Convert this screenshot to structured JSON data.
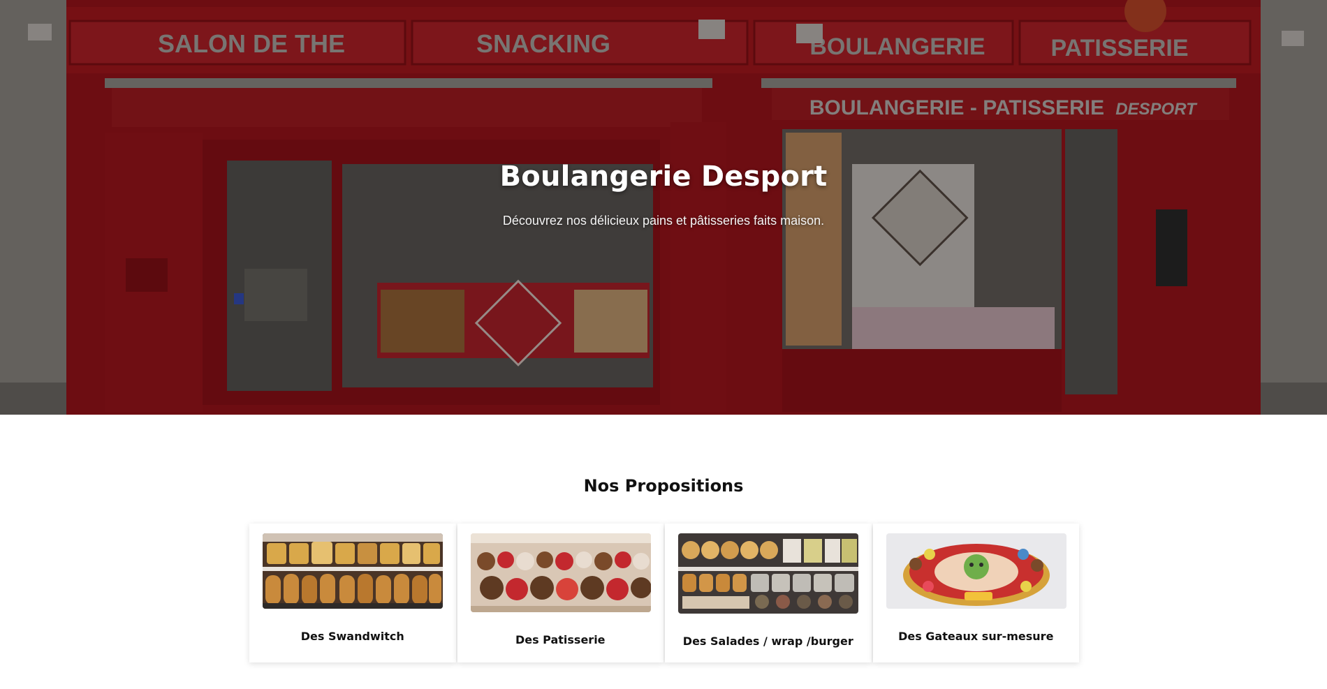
{
  "hero": {
    "title": "Boulangerie Desport",
    "subtitle": "Découvrez nos délicieux pains et pâtisseries faits maison.",
    "storefront_signs": [
      "SALON DE THE",
      "SNACKING",
      "BOULANGERIE",
      "PATISSERIE",
      "BOULANGERIE - PATISSERIE",
      "DESPORT"
    ],
    "store_red": "#c8202a"
  },
  "propositions": {
    "title": "Nos Propositions",
    "cards": [
      {
        "label": "Des Swandwitch",
        "icon": "sandwich-photo"
      },
      {
        "label": "Des Patisserie",
        "icon": "pastry-photo"
      },
      {
        "label": "Des Salades / wrap /burger",
        "icon": "salad-wrap-burger-photo"
      },
      {
        "label": "Des Gateaux sur-mesure",
        "icon": "custom-cake-photo"
      }
    ]
  }
}
